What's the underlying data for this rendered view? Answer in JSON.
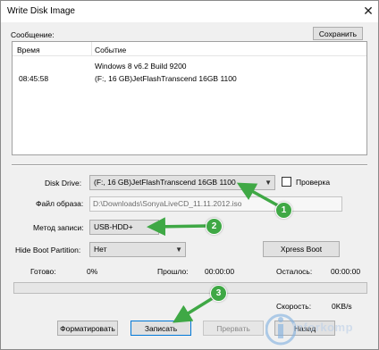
{
  "window": {
    "title": "Write Disk Image",
    "close_glyph": "✕"
  },
  "message_label": "Сообщение:",
  "save_button": "Сохранить",
  "log": {
    "columns": [
      "Время",
      "Событие"
    ],
    "rows": [
      {
        "time": "",
        "event": "Windows 8 v6.2 Build 9200"
      },
      {
        "time": "08:45:58",
        "event": "(F:, 16 GB)JetFlashTranscend 16GB  1100"
      }
    ]
  },
  "disk_drive": {
    "label": "Disk Drive:",
    "value": "(F:, 16 GB)JetFlashTranscend 16GB  1100"
  },
  "verify": {
    "label": "Проверка",
    "checked": false
  },
  "image_file": {
    "label": "Файл образа:",
    "value": "D:\\Downloads\\SonyaLiveCD_11.11.2012.iso"
  },
  "write_method": {
    "label": "Метод записи:",
    "value": "USB-HDD+"
  },
  "hide_boot": {
    "label": "Hide Boot Partition:",
    "value": "Нет"
  },
  "xpress_boot_button": "Xpress Boot",
  "status": {
    "done_label": "Готово:",
    "done_value": "0%",
    "elapsed_label": "Прошло:",
    "elapsed_value": "00:00:00",
    "remaining_label": "Осталось:",
    "remaining_value": "00:00:00",
    "speed_label": "Скорость:",
    "speed_value": "0KB/s"
  },
  "progress": {
    "fraction": 0
  },
  "buttons": {
    "format": "Форматировать",
    "write": "Записать",
    "abort": "Прервать",
    "back": "Назад"
  },
  "annotations": {
    "badge1": "1",
    "badge2": "2",
    "badge3": "3",
    "arrow_color": "#3fa845"
  },
  "watermark": {
    "text": "Inforkomp"
  },
  "icons": {
    "dropdown": "chevron-down-icon",
    "close": "close-icon"
  }
}
